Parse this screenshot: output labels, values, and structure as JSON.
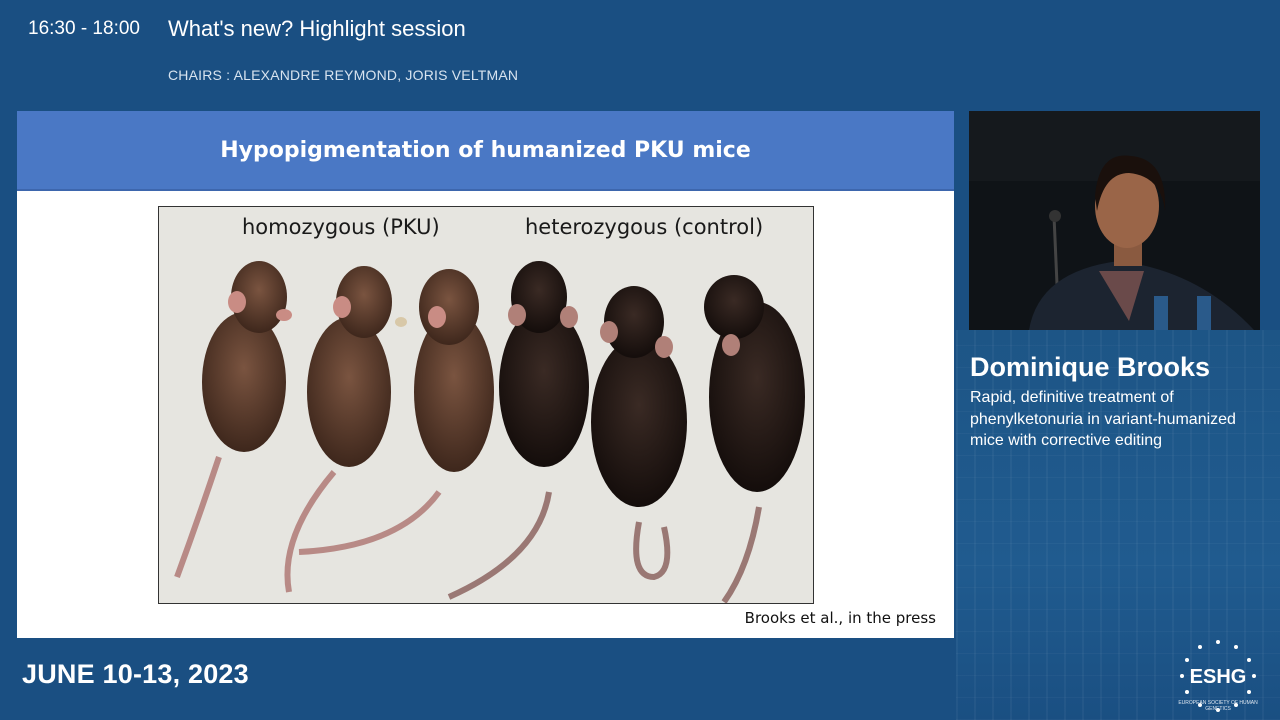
{
  "header": {
    "time": "16:30 - 18:00",
    "session_title": "What's new? Highlight session",
    "chairs": "CHAIRS : ALEXANDRE REYMOND, JORIS VELTMAN"
  },
  "slide": {
    "title": "Hypopigmentation of humanized PKU mice",
    "label_left": "homozygous (PKU)",
    "label_right": "heterozygous (control)",
    "citation": "Brooks et al., in the press"
  },
  "speaker": {
    "name": "Dominique Brooks",
    "talk_title": "Rapid, definitive treatment of phenylketonuria in variant-humanized mice with corrective editing"
  },
  "footer": {
    "dates": "JUNE 10-13, 2023",
    "logo_text": "ESHG",
    "logo_subtext": "EUROPEAN SOCIETY OF HUMAN GENETICS"
  },
  "colors": {
    "background": "#1a4f82",
    "slide_header": "#4a78c5",
    "pku_mouse": "#5a3a2a",
    "control_mouse": "#1f1512"
  }
}
